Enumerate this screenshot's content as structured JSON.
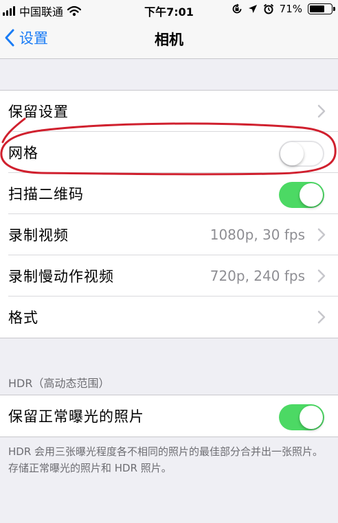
{
  "status_bar": {
    "carrier": "中国联通",
    "time": "下午7:01",
    "battery_percent": "71%",
    "battery_level": 0.71,
    "icons": [
      "signal-icon",
      "wifi-icon",
      "rotation-lock-icon",
      "location-icon",
      "alarm-icon",
      "battery-icon"
    ]
  },
  "nav": {
    "back_label": "设置",
    "title": "相机"
  },
  "settings": {
    "preserve_settings": "保留设置",
    "grid": "网格",
    "grid_on": false,
    "scan_qr": "扫描二维码",
    "scan_qr_on": true,
    "record_video": "录制视频",
    "record_video_value": "1080p, 30 fps",
    "record_slomo": "录制慢动作视频",
    "record_slomo_value": "720p, 240 fps",
    "formats": "格式"
  },
  "hdr": {
    "header": "HDR（高动态范围）",
    "keep_normal_photo": "保留正常曝光的照片",
    "keep_normal_photo_on": true,
    "footnote": "HDR 会用三张曝光程度各不相同的照片的最佳部分合并出一张照片。存储正常曝光的照片和 HDR 照片。"
  },
  "colors": {
    "accent_blue": "#1a7cf5",
    "toggle_on_green": "#4cd964",
    "annotation_red": "#d0202e",
    "background": "#efeff4"
  }
}
